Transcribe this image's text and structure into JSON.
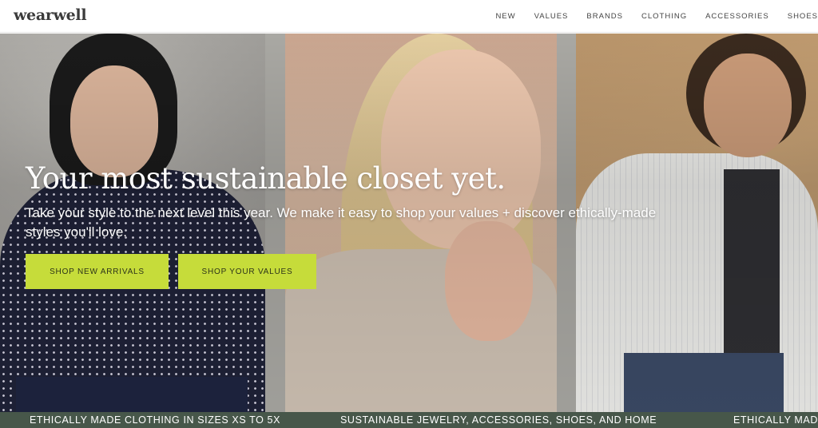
{
  "brand": {
    "logo_text": "wearwell"
  },
  "nav": {
    "items": [
      "NEW",
      "VALUES",
      "BRANDS",
      "CLOTHING",
      "ACCESSORIES",
      "SHOES"
    ]
  },
  "hero": {
    "title": "Your most sustainable closet yet.",
    "subtitle": "Take your style to the next level this year. We make it easy to shop your values + discover ethically-made styles you'll love.",
    "cta_primary": "SHOP NEW ARRIVALS",
    "cta_secondary": "SHOP YOUR VALUES"
  },
  "ticker": {
    "items": [
      "ETHICALLY MADE CLOTHING IN SIZES XS TO 5X",
      "SUSTAINABLE JEWELRY, ACCESSORIES, SHOES, AND HOME",
      "ETHICALLY MAD"
    ]
  },
  "colors": {
    "accent": "#c6dc3a",
    "ticker_bg": "#47574a",
    "header_bg": "#ffffff"
  }
}
